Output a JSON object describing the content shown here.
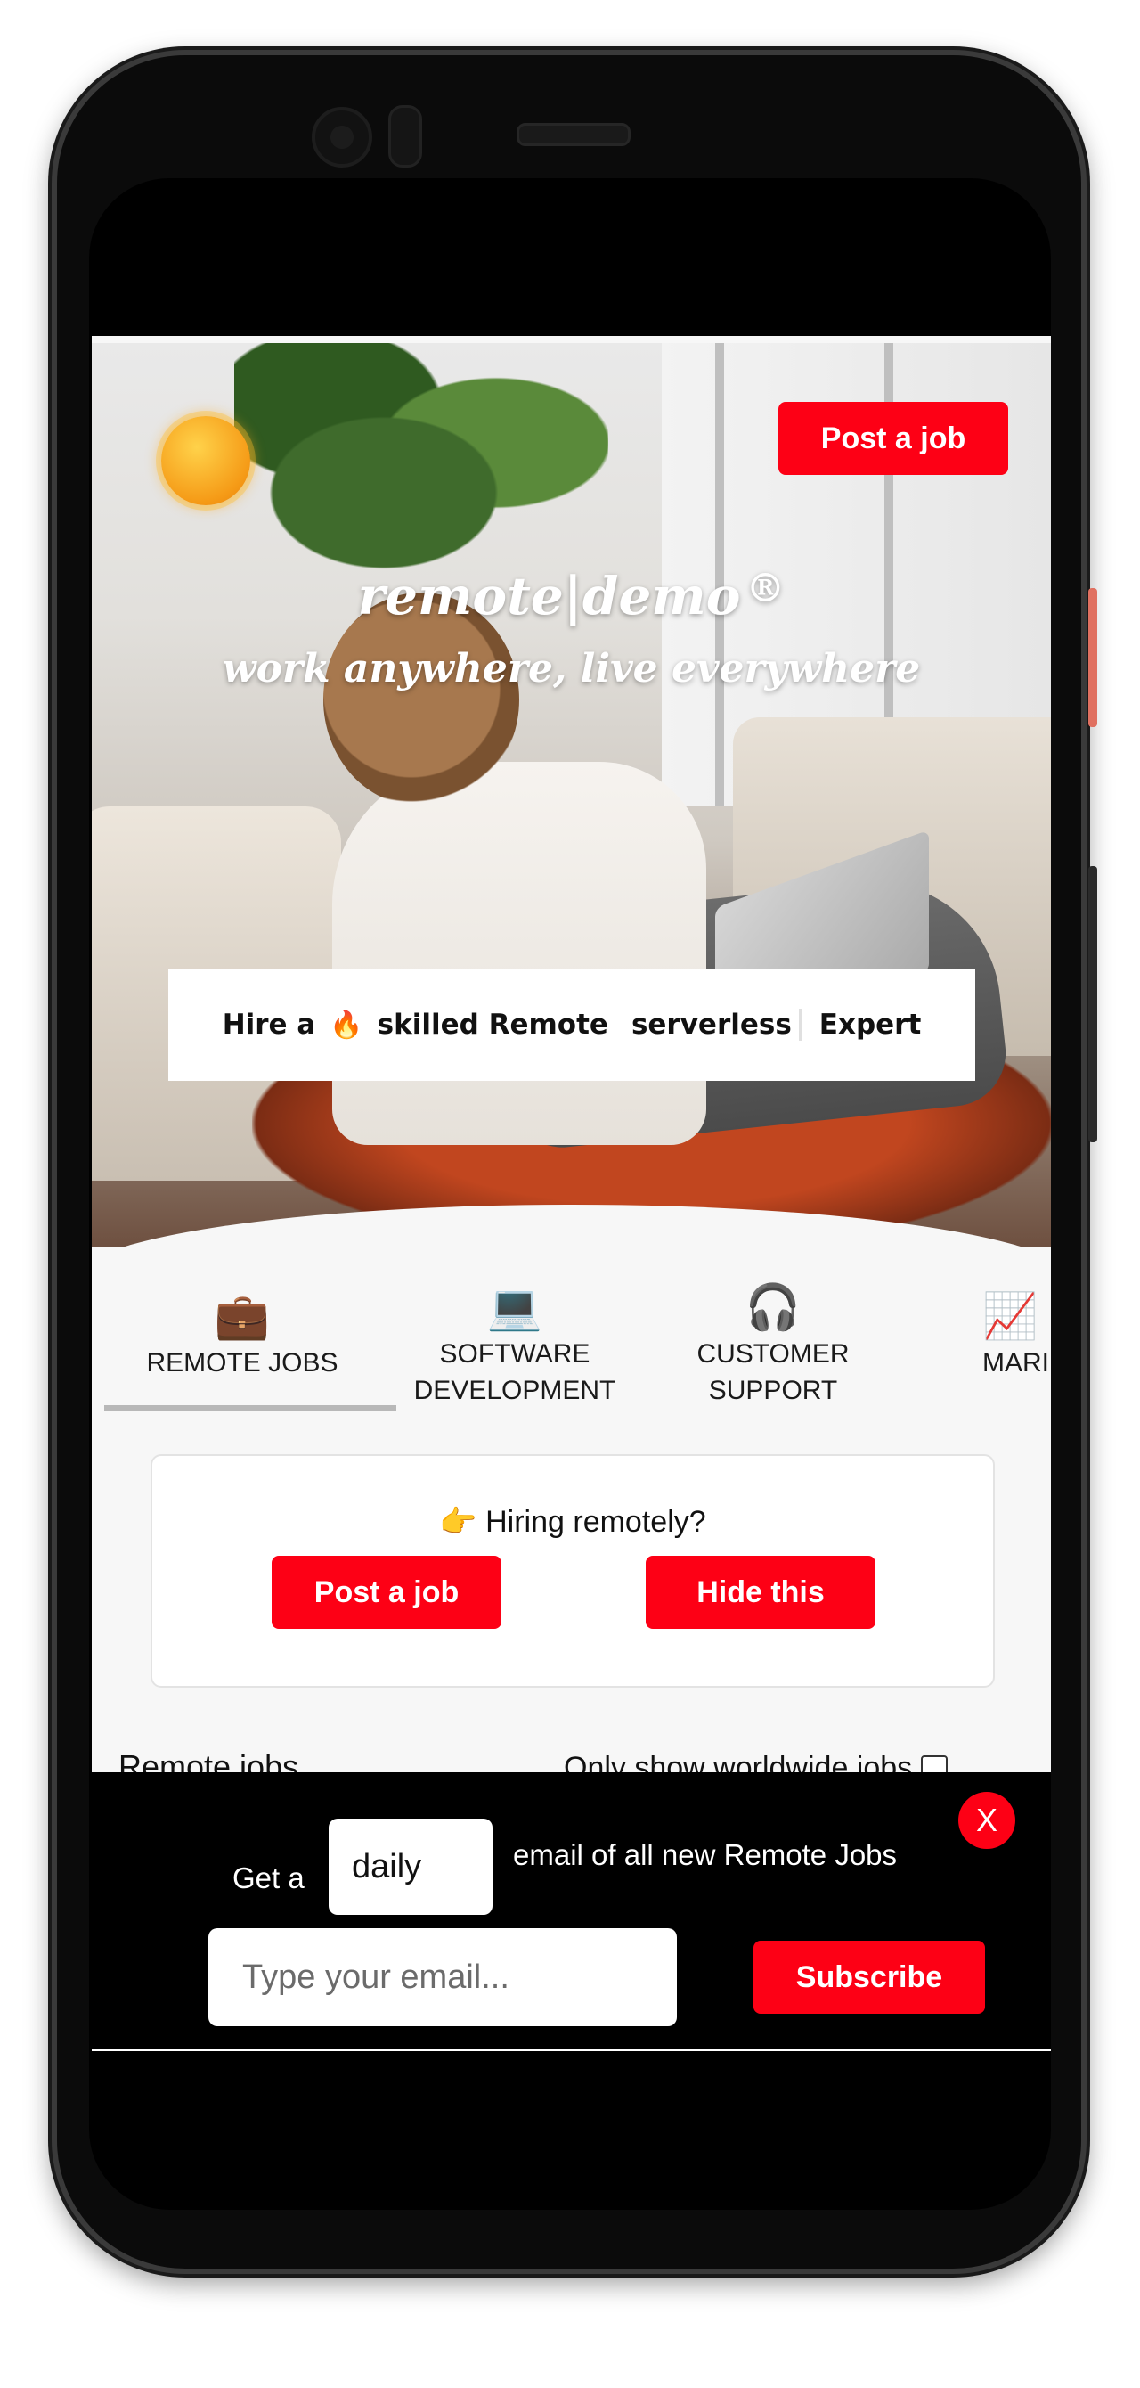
{
  "hero": {
    "post_job_label": "Post a job",
    "brand_left": "remote",
    "brand_sep": "|",
    "brand_right": "demo",
    "brand_mark": "®",
    "tagline": "work anywhere, live everywhere",
    "hire": {
      "prefix": "Hire a",
      "emoji": "🔥",
      "middle": "skilled Remote",
      "rotating_word": "serverless",
      "suffix": "Expert"
    }
  },
  "categories": [
    {
      "icon": "💼",
      "icon_name": "briefcase-icon",
      "label_line1": "REMOTE JOBS",
      "label_line2": ""
    },
    {
      "icon": "💻",
      "icon_name": "laptop-icon",
      "label_line1": "SOFTWARE",
      "label_line2": "DEVELOPMENT"
    },
    {
      "icon": "🎧",
      "icon_name": "headphones-icon",
      "label_line1": "CUSTOMER",
      "label_line2": "SUPPORT"
    },
    {
      "icon": "📈",
      "icon_name": "chart-icon",
      "label_line1": "MARI",
      "label_line2": ""
    }
  ],
  "hiring_card": {
    "title": "👉 Hiring remotely?",
    "post_label": "Post a job",
    "hide_label": "Hide this"
  },
  "jobs": {
    "title": "Remote jobs",
    "worldwide_label": "Only show worldwide jobs"
  },
  "email_bar": {
    "get_a": "Get a",
    "frequency": "daily",
    "email_of": "email of all new Remote Jobs",
    "email_placeholder": "Type your email...",
    "subscribe_label": "Subscribe",
    "close_label": "X"
  },
  "colors": {
    "accent": "#fd0015",
    "bar_bg": "#000000",
    "page_bg": "#f7f7f7"
  }
}
